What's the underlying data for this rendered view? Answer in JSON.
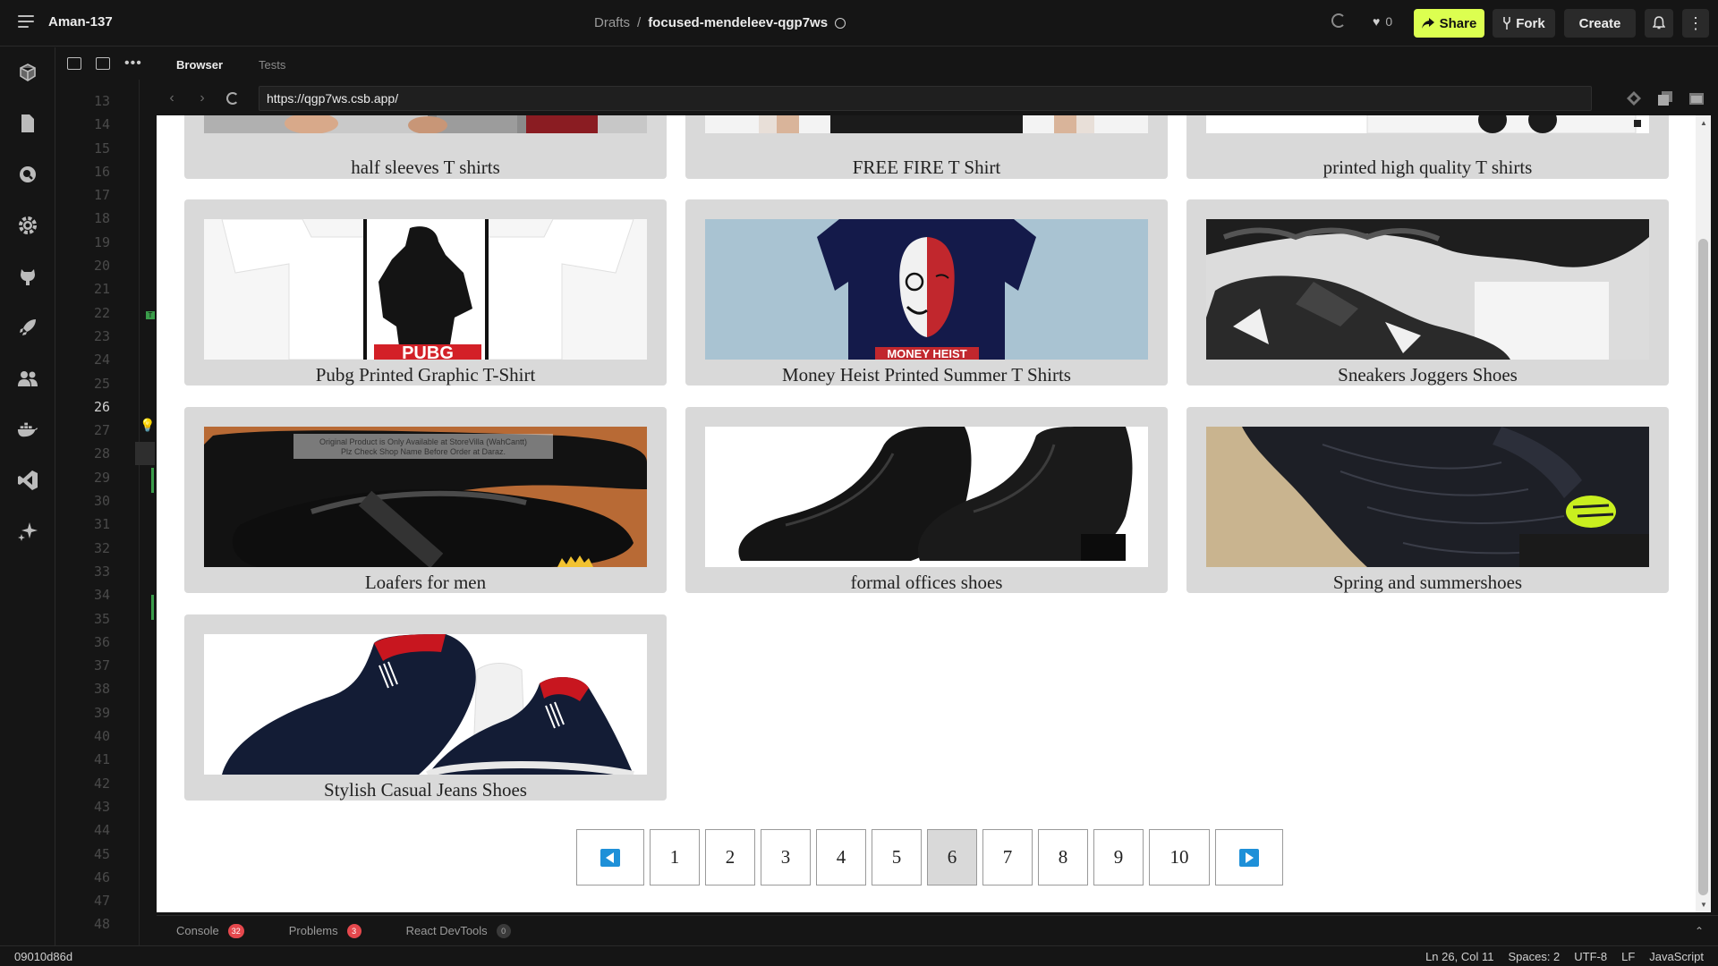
{
  "topbar": {
    "user": "Aman-137",
    "breadcrumb_root": "Drafts",
    "breadcrumb_sep": "/",
    "project": "focused-mendeleev-qgp7ws",
    "likes": "0",
    "share": "Share",
    "fork": "Fork",
    "create": "Create"
  },
  "editor": {
    "lines": [
      "13",
      "14",
      "15",
      "16",
      "17",
      "18",
      "19",
      "20",
      "21",
      "22",
      "23",
      "24",
      "25",
      "26",
      "27",
      "28",
      "29",
      "30",
      "31",
      "32",
      "33",
      "34",
      "35",
      "36",
      "37",
      "38",
      "39",
      "40",
      "41",
      "42",
      "43",
      "44",
      "45",
      "46",
      "47",
      "48"
    ],
    "current_line": "26"
  },
  "browser": {
    "tab_browser": "Browser",
    "tab_tests": "Tests",
    "url": "https://qgp7ws.csb.app/"
  },
  "products": [
    {
      "title": "half sleeves T shirts",
      "image": "shirt-photo"
    },
    {
      "title": "FREE FIRE T Shirt",
      "image": "shirt-photo"
    },
    {
      "title": "printed high quality T shirts",
      "image": "shirt-photo"
    },
    {
      "title": "Pubg Printed Graphic T-Shirt",
      "image": "pubg-tshirt"
    },
    {
      "title": "Money Heist Printed Summer T Shirts",
      "image": "money-heist-tshirt",
      "image_text": "MONEY HEIST"
    },
    {
      "title": "Sneakers Joggers Shoes",
      "image": "black-sneaker"
    },
    {
      "title": "Loafers for men",
      "image": "black-loafer",
      "image_text": "Original Product is Only Available at StoreVilla (WahCantt) Plz Check Shop Name Before Order at Daraz."
    },
    {
      "title": "formal offices shoes",
      "image": "formal-shoes"
    },
    {
      "title": "Spring and summershoes",
      "image": "mesh-shoe"
    },
    {
      "title": "Stylish Casual Jeans Shoes",
      "image": "navy-slipons"
    }
  ],
  "pagination": {
    "pages": [
      "1",
      "2",
      "3",
      "4",
      "5",
      "6",
      "7",
      "8",
      "9",
      "10"
    ],
    "current": "6"
  },
  "bottom": {
    "console": "Console",
    "console_count": "32",
    "problems": "Problems",
    "problems_count": "3",
    "devtools": "React DevTools",
    "devtools_count": "0"
  },
  "status": {
    "commit": "09010d86d",
    "position": "Ln 26, Col 11",
    "spaces": "Spaces: 2",
    "encoding": "UTF-8",
    "eol": "LF",
    "language": "JavaScript"
  },
  "colors": {
    "accent": "#dcff50",
    "pager_arrow": "#1e90d8",
    "card_bg": "#d9d9d9"
  }
}
